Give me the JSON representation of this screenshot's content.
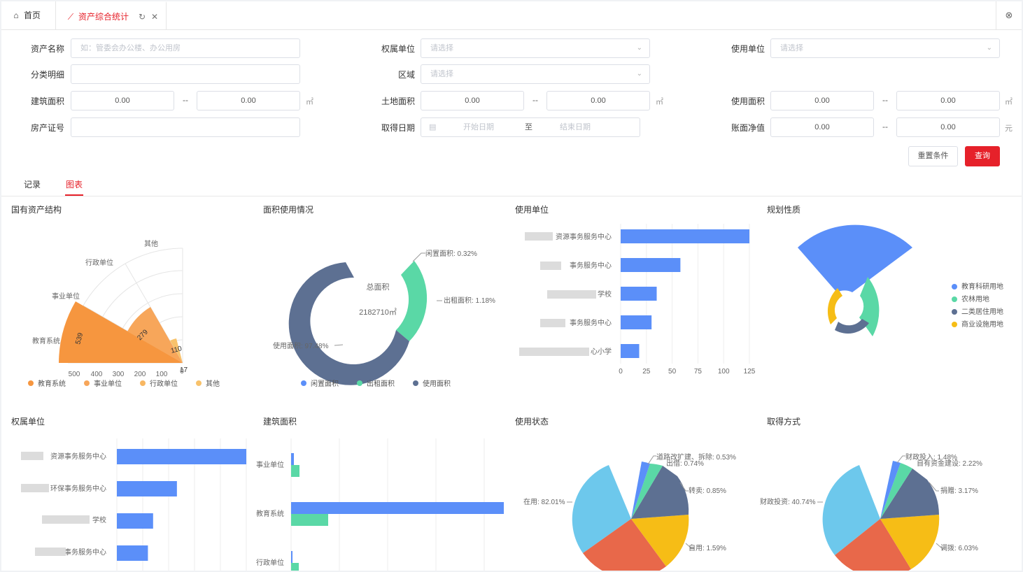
{
  "tabs": {
    "home": "首页",
    "active": "资产综合统计"
  },
  "form": {
    "asset_name": {
      "label": "资产名称",
      "placeholder": "如：管委会办公楼、办公用房"
    },
    "owner_unit": {
      "label": "权属单位",
      "placeholder": "请选择"
    },
    "use_unit": {
      "label": "使用单位",
      "placeholder": "请选择"
    },
    "category": {
      "label": "分类明细"
    },
    "region": {
      "label": "区域",
      "placeholder": "请选择"
    },
    "build_area": {
      "label": "建筑面积",
      "min": "0.00",
      "max": "0.00",
      "unit": "㎡"
    },
    "land_area": {
      "label": "土地面积",
      "min": "0.00",
      "max": "0.00",
      "unit": "㎡"
    },
    "usage_area": {
      "label": "使用面积",
      "min": "0.00",
      "max": "0.00",
      "unit": "㎡"
    },
    "cert_no": {
      "label": "房产证号"
    },
    "acquire_date": {
      "label": "取得日期",
      "start": "开始日期",
      "to": "至",
      "end": "结束日期"
    },
    "book_value": {
      "label": "账面净值",
      "min": "0.00",
      "max": "0.00",
      "unit": "元"
    },
    "dash": "--"
  },
  "buttons": {
    "reset": "重置条件",
    "query": "查询"
  },
  "subtabs": {
    "records": "记录",
    "charts": "图表"
  },
  "colors": {
    "accent": "#e6212a",
    "blue": "#5b8ff9",
    "green": "#5ad8a6",
    "slate": "#5d7092",
    "orange": "#f6963f",
    "yellow": "#f6bd16",
    "skyblue": "#6dc8ec",
    "red": "#e8684a"
  },
  "chart_data": [
    {
      "id": "state-asset-structure",
      "type": "polar-bar",
      "title": "国有资产结构",
      "categories": [
        "教育系统",
        "事业单位",
        "行政单位",
        "其他"
      ],
      "values": [
        539,
        0,
        279,
        110
      ],
      "radial_ticks": [
        "500",
        "400",
        "300",
        "200",
        "100",
        "0"
      ],
      "legend": [
        "教育系统",
        "事业单位",
        "行政单位",
        "其他"
      ],
      "extra_value_label": "17"
    },
    {
      "id": "area-usage",
      "type": "donut",
      "title": "面积使用情况",
      "center_label": "总面积",
      "center_value": "2182710㎡",
      "slices": [
        {
          "name": "闲置面积",
          "label": "闲置面积: 0.32%",
          "value": 0.32
        },
        {
          "name": "出租面积",
          "label": "出租面积: 1.18%",
          "value": 1.18
        },
        {
          "name": "使用面积",
          "label": "使用面积: 97.48%",
          "value": 97.48
        }
      ],
      "legend": [
        "闲置面积",
        "出租面积",
        "使用面积"
      ]
    },
    {
      "id": "use-unit",
      "type": "bar",
      "title": "使用单位",
      "categories": [
        "资源事务服务中心",
        "事务服务中心",
        "学校",
        "事务服务中心",
        "心小学"
      ],
      "values": [
        125,
        58,
        35,
        30,
        18
      ],
      "xticks": [
        "0",
        "25",
        "50",
        "75",
        "100",
        "125"
      ]
    },
    {
      "id": "planning-nature",
      "type": "rose",
      "title": "规划性质",
      "legend": [
        "教育科研用地",
        "农林用地",
        "二类居住用地",
        "商业设施用地"
      ]
    },
    {
      "id": "owner-unit",
      "type": "bar",
      "title": "权属单位",
      "categories": [
        "资源事务服务中心",
        "环保事务服务中心",
        "学校",
        "事务服务中心"
      ],
      "values": [
        125,
        58,
        35,
        30
      ]
    },
    {
      "id": "building-area",
      "type": "bar",
      "title": "建筑面积",
      "categories": [
        "事业单位",
        "教育系统",
        "行政单位"
      ]
    },
    {
      "id": "usage-status",
      "type": "pie",
      "title": "使用状态",
      "slices": [
        {
          "name": "在用",
          "label": "在用: 82.01%",
          "value": 82.01
        },
        {
          "name": "道路改扩建、拆除",
          "label": "道路改扩建、拆除: 0.53%",
          "value": 0.53
        },
        {
          "name": "出借",
          "label": "出借: 0.74%",
          "value": 0.74
        },
        {
          "name": "转卖",
          "label": "转卖: 0.85%",
          "value": 0.85
        },
        {
          "name": "自用",
          "label": "自用: 1.59%",
          "value": 1.59
        }
      ]
    },
    {
      "id": "acquire-method",
      "type": "pie",
      "title": "取得方式",
      "slices": [
        {
          "name": "财政投资",
          "label": "财政投资: 40.74%",
          "value": 40.74
        },
        {
          "name": "财政投入",
          "label": "财政投入: 1.48%",
          "value": 1.48
        },
        {
          "name": "自有资金建设",
          "label": "自有资金建设: 2.22%",
          "value": 2.22
        },
        {
          "name": "捐赠",
          "label": "捐赠: 3.17%",
          "value": 3.17
        },
        {
          "name": "调拨",
          "label": "调拨: 6.03%",
          "value": 6.03
        }
      ]
    }
  ]
}
